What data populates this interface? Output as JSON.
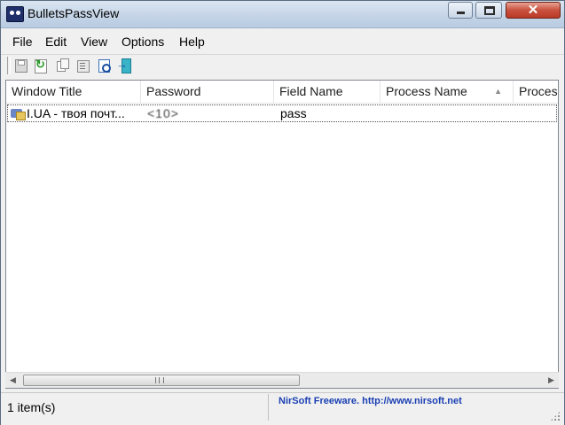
{
  "window": {
    "title": "BulletsPassView",
    "close_glyph": "✕"
  },
  "menu": [
    "File",
    "Edit",
    "View",
    "Options",
    "Help"
  ],
  "toolbar": {
    "icons": [
      "save-icon",
      "refresh-icon",
      "copy-icon",
      "properties-icon",
      "find-icon",
      "exit-icon"
    ]
  },
  "table": {
    "columns": [
      "Window Title",
      "Password",
      "Field Name",
      "Process Name",
      "Proces"
    ],
    "sort_indicator": "▲",
    "rows": [
      {
        "window_title": "I.UA - твоя почт...",
        "password": "<10>",
        "field_name": "pass",
        "process_name": "",
        "process_path": ""
      }
    ]
  },
  "scrollbar": {
    "left_arrow": "◀",
    "right_arrow": "▶",
    "position": 0.0
  },
  "status": {
    "item_count": "1 item(s)",
    "link_text": "NirSoft Freeware.  http://www.nirsoft.net"
  },
  "colors": {
    "link": "#1a3fb3",
    "close_button": "#c9513e"
  }
}
